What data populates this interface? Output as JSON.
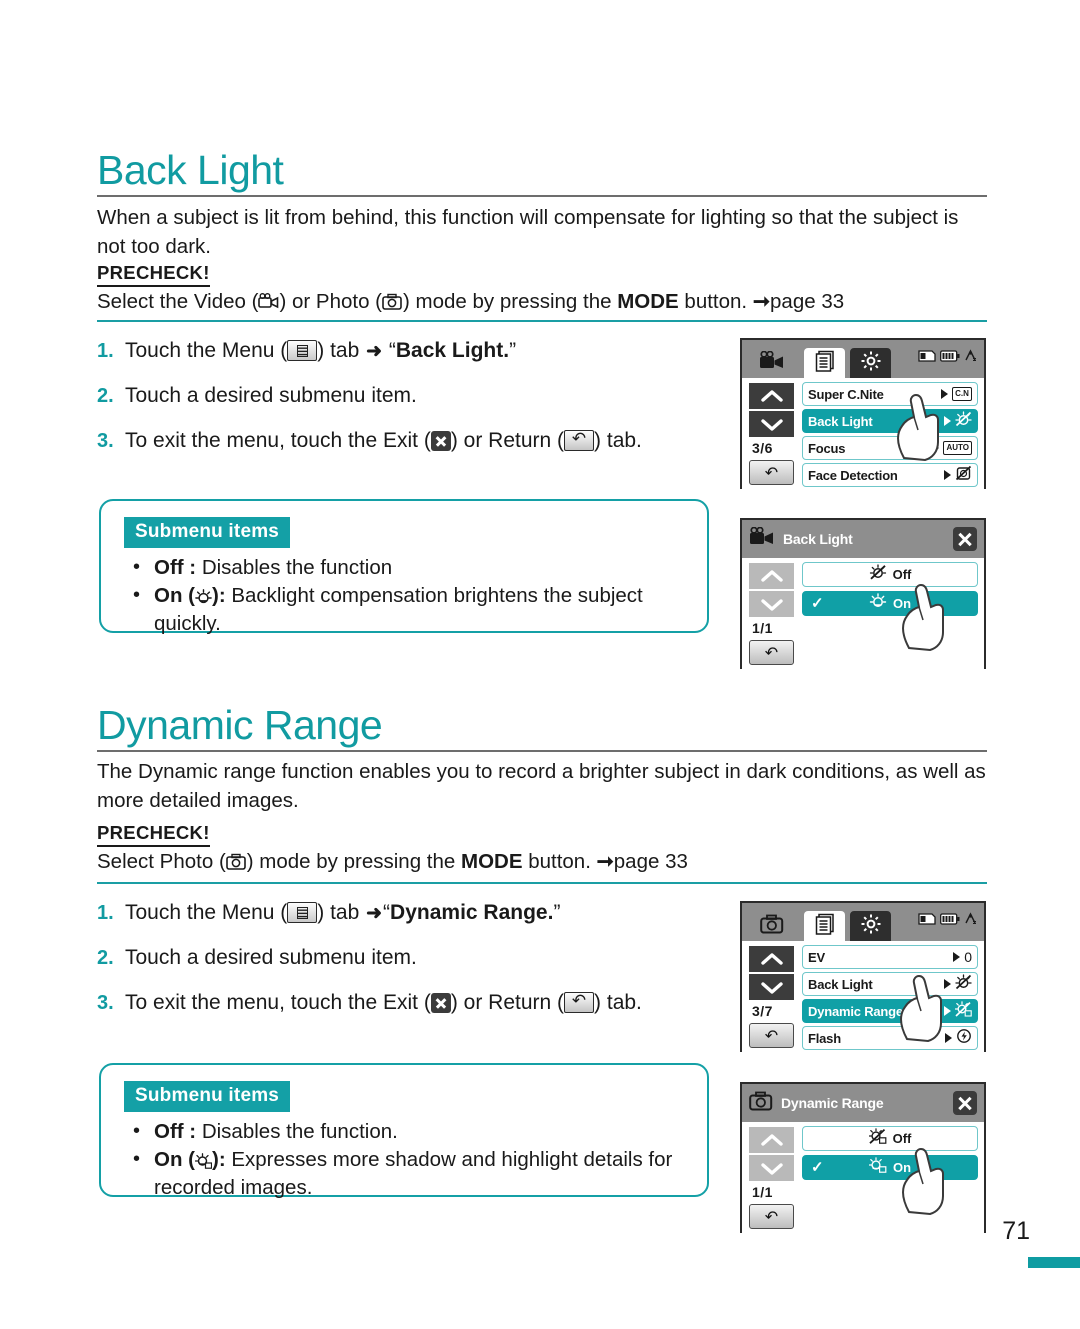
{
  "page": {
    "number": "71",
    "accent_color": "#0f9ca2",
    "heading_color": "#119ba1"
  },
  "sections": [
    {
      "title": "Back Light",
      "intro": "When a subject is lit from behind, this function will compensate for lighting so that the subject is not too dark.",
      "precheck_label": "PRECHECK!",
      "precheck_parts": {
        "a": "Select the Video (",
        "b": ") or Photo (",
        "c": ") mode by pressing the ",
        "mode": "MODE",
        "d": " button. ",
        "page_ref": "page 33"
      },
      "steps": [
        {
          "num": "1.",
          "a": "Touch the Menu (",
          "b": ") tab ",
          "arrow": "➜",
          "c": " “",
          "bold": "Back Light.",
          "d": "”"
        },
        {
          "num": "2.",
          "a": "Touch a desired submenu item."
        },
        {
          "num": "3.",
          "a": "To exit the menu, touch the Exit (",
          "b": ") or Return (",
          "c": ") tab."
        }
      ],
      "submenu_box": {
        "badge": "Submenu items",
        "items": [
          {
            "name": "Off",
            "sep": " : ",
            "desc": "Disables the function",
            "icon": ""
          },
          {
            "name": "On",
            "sep": "): ",
            "open": " (",
            "desc": "Backlight compensation brightens the subject quickly.",
            "icon": "backlight-on-icon"
          }
        ]
      },
      "lcd_menu": {
        "mode_icon": "video-camera-icon",
        "tabs": [
          "mode-tab",
          "menu-tab",
          "setting-tab"
        ],
        "status_icons": [
          "card-icon",
          "battery-icon",
          "network-icon"
        ],
        "page_indicator": "3/6",
        "return_glyph": "↶",
        "rows": [
          {
            "label": "Super C.Nite",
            "value": "C.N",
            "value_type": "box",
            "selected": false
          },
          {
            "label": "Back Light",
            "value": "backlight-off-icon",
            "value_type": "glyph",
            "selected": true
          },
          {
            "label": "Focus",
            "value": "AUTO",
            "value_type": "box",
            "selected": false
          },
          {
            "label": "Face Detection",
            "value": "face-detect-icon",
            "value_type": "glyph",
            "selected": false
          }
        ]
      },
      "lcd_submenu": {
        "mode_icon": "video-camera-icon",
        "title": "Back Light",
        "page_indicator": "1/1",
        "return_glyph": "↶",
        "rows": [
          {
            "label": "Off",
            "icon": "backlight-off-icon",
            "selected": false,
            "checked": false
          },
          {
            "label": "On",
            "icon": "backlight-on-icon",
            "selected": true,
            "checked": true
          }
        ]
      }
    },
    {
      "title": "Dynamic Range",
      "intro": "The Dynamic range function enables you to record a brighter subject in dark conditions, as well as more detailed images.",
      "precheck_label": "PRECHECK!",
      "precheck_parts": {
        "a": "Select Photo (",
        "b": ") mode by pressing the ",
        "mode": "MODE",
        "d": " button. ",
        "page_ref": "page 33"
      },
      "steps": [
        {
          "num": "1.",
          "a": "Touch the Menu (",
          "b": ") tab ",
          "arrow": "➜",
          "c": "“",
          "bold": "Dynamic Range.",
          "d": "”"
        },
        {
          "num": "2.",
          "a": "Touch a desired submenu item."
        },
        {
          "num": "3.",
          "a": "To exit the menu, touch the Exit (",
          "b": ") or Return (",
          "c": ") tab."
        }
      ],
      "submenu_box": {
        "badge": "Submenu items",
        "items": [
          {
            "name": "Off",
            "sep": " : ",
            "desc": "Disables the function.",
            "icon": ""
          },
          {
            "name": "On",
            "sep": "): ",
            "open": " (",
            "desc": "Expresses more shadow and highlight details for recorded images.",
            "icon": "dynamic-range-on-icon"
          }
        ]
      },
      "lcd_menu": {
        "mode_icon": "photo-camera-icon",
        "tabs": [
          "mode-tab",
          "menu-tab",
          "setting-tab"
        ],
        "status_icons": [
          "card-icon",
          "battery-icon",
          "network-icon"
        ],
        "page_indicator": "3/7",
        "return_glyph": "↶",
        "rows": [
          {
            "label": "EV",
            "value": "0",
            "value_type": "plain",
            "selected": false
          },
          {
            "label": "Back Light",
            "value": "backlight-off-icon",
            "value_type": "glyph",
            "selected": false
          },
          {
            "label": "Dynamic Range",
            "value": "dynamic-range-off-icon",
            "value_type": "glyph",
            "selected": true
          },
          {
            "label": "Flash",
            "value": "flash-icon",
            "value_type": "glyph",
            "selected": false
          }
        ]
      },
      "lcd_submenu": {
        "mode_icon": "photo-camera-icon",
        "title": "Dynamic Range",
        "page_indicator": "1/1",
        "return_glyph": "↶",
        "rows": [
          {
            "label": "Off",
            "icon": "dynamic-range-off-icon",
            "selected": false,
            "checked": false
          },
          {
            "label": "On",
            "icon": "dynamic-range-on-icon",
            "selected": true,
            "checked": true
          }
        ]
      }
    }
  ]
}
